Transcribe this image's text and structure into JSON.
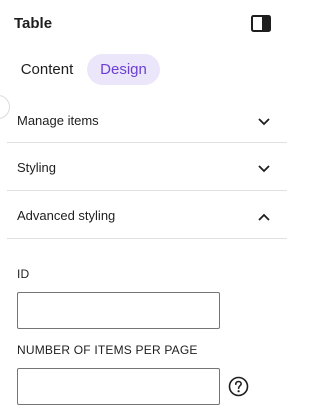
{
  "header": {
    "title": "Table"
  },
  "tabs": [
    {
      "label": "Content",
      "active": false
    },
    {
      "label": "Design",
      "active": true
    }
  ],
  "sections": [
    {
      "label": "Manage items",
      "expanded": false
    },
    {
      "label": "Styling",
      "expanded": false
    },
    {
      "label": "Advanced styling",
      "expanded": true
    }
  ],
  "fields": {
    "id": {
      "label": "ID",
      "value": ""
    },
    "items_per_page": {
      "label": "NUMBER OF ITEMS PER PAGE",
      "value": ""
    }
  },
  "colors": {
    "accent": "#6b3fd4",
    "accent_bg": "#ece6fa",
    "divider": "#e0e0e0"
  },
  "icons": [
    "sidebar-toggle-icon",
    "chevron-down-icon",
    "chevron-up-icon",
    "help-icon"
  ]
}
